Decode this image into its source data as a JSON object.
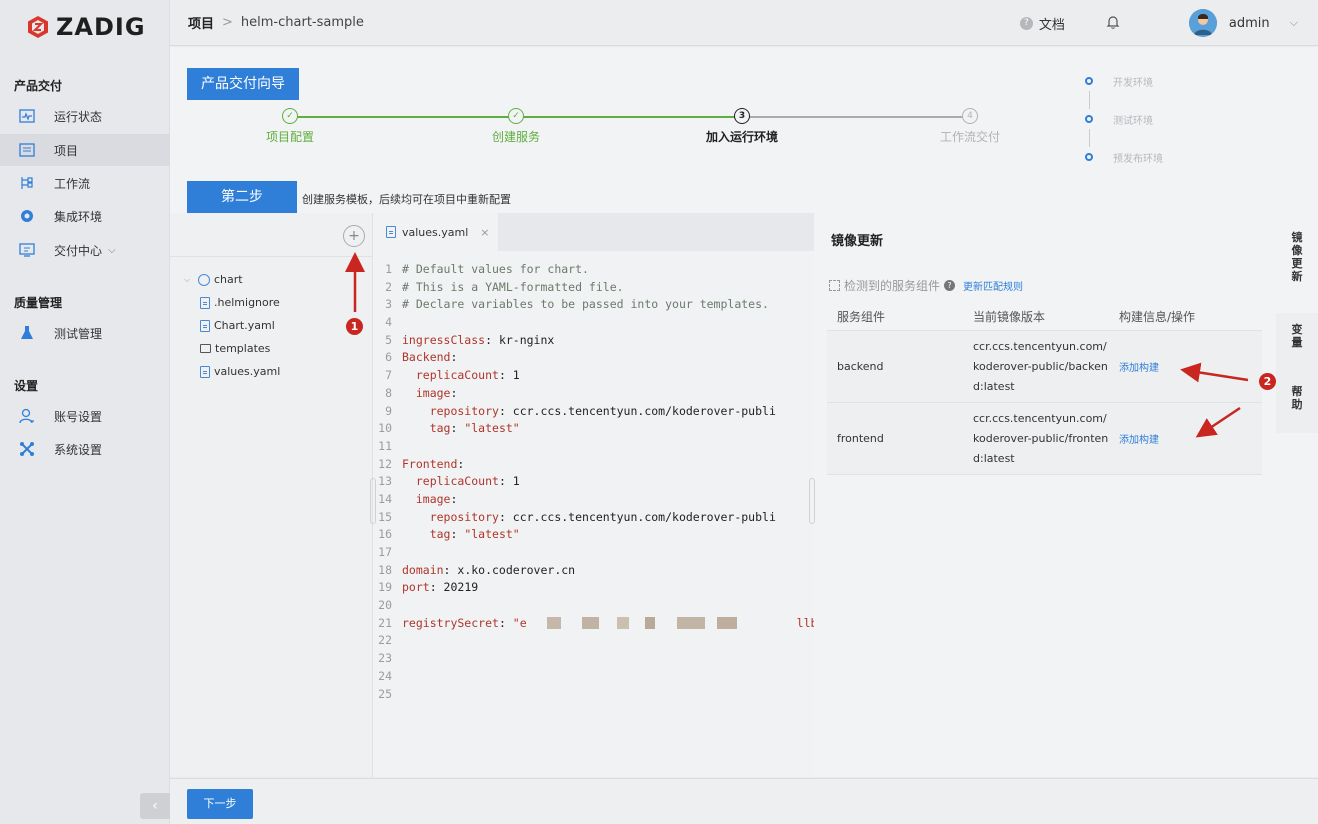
{
  "brand": {
    "name": "ZADIG"
  },
  "sidebar": {
    "sections": [
      {
        "title": "产品交付"
      },
      {
        "title": "质量管理"
      },
      {
        "title": "设置"
      }
    ],
    "items": [
      {
        "label": "运行状态",
        "icon": "pulse-icon"
      },
      {
        "label": "项目",
        "icon": "project-icon",
        "active": true
      },
      {
        "label": "工作流",
        "icon": "workflow-icon"
      },
      {
        "label": "集成环境",
        "icon": "cluster-icon"
      },
      {
        "label": "交付中心",
        "icon": "delivery-icon"
      },
      {
        "label": "测试管理",
        "icon": "flask-icon"
      },
      {
        "label": "账号设置",
        "icon": "user-icon"
      },
      {
        "label": "系统设置",
        "icon": "system-icon"
      }
    ],
    "collapse_label": "‹"
  },
  "header": {
    "breadcrumb_root": "项目",
    "breadcrumb_sep": ">",
    "breadcrumb_current": "helm-chart-sample",
    "docs_label": "文档",
    "user_name": "admin"
  },
  "wizard": {
    "title": "产品交付向导",
    "steps": [
      {
        "label": "项目配置",
        "state": "done"
      },
      {
        "label": "创建服务",
        "state": "done"
      },
      {
        "label": "加入运行环境",
        "state": "current",
        "num": "3"
      },
      {
        "label": "工作流交付",
        "state": "pending",
        "num": "4"
      }
    ],
    "environments": [
      "开发环境",
      "测试环境",
      "预发布环境"
    ],
    "step2_badge": "第二步",
    "step2_desc": "创建服务模板，后续均可在项目中重新配置"
  },
  "file_tree": {
    "add_label": "+",
    "root": "chart",
    "children": [
      ".helmignore",
      "Chart.yaml",
      "templates",
      "values.yaml"
    ]
  },
  "editor": {
    "tab_label": "values.yaml",
    "tab_close": "×",
    "lines": [
      "# Default values for chart.",
      "# This is a YAML-formatted file.",
      "# Declare variables to be passed into your templates.",
      "",
      "ingressClass: kr-nginx",
      "Backend:",
      "  replicaCount: 1",
      "  image:",
      "    repository: ccr.ccs.tencentyun.com/koderover-publi",
      "    tag: \"latest\"",
      "",
      "Frontend:",
      "  replicaCount: 1",
      "  image:",
      "    repository: ccr.ccs.tencentyun.com/koderover-publi",
      "    tag: \"latest\"",
      "",
      "domain: x.ko.coderover.cn",
      "port: 20219",
      "",
      "registrySecret: \"e",
      "",
      "",
      "",
      ""
    ],
    "secret_tail": "llb"
  },
  "image_update": {
    "title": "镜像更新",
    "detected_label": "检测到的服务组件",
    "rule_link": "更新匹配规则",
    "columns": [
      "服务组件",
      "当前镜像版本",
      "构建信息/操作"
    ],
    "rows": [
      {
        "component": "backend",
        "image": "ccr.ccs.tencentyun.com/koderover-public/backend:latest",
        "action": "添加构建"
      },
      {
        "component": "frontend",
        "image": "ccr.ccs.tencentyun.com/koderover-public/frontend:latest",
        "action": "添加构建"
      }
    ]
  },
  "side_tabs": [
    "镜像更新",
    "变量",
    "帮助"
  ],
  "footer": {
    "next_label": "下一步"
  },
  "annotations": [
    "1",
    "2"
  ],
  "colors": {
    "accent": "#2f7fd8",
    "success": "#5fae3e",
    "annotation": "#c8261e"
  }
}
